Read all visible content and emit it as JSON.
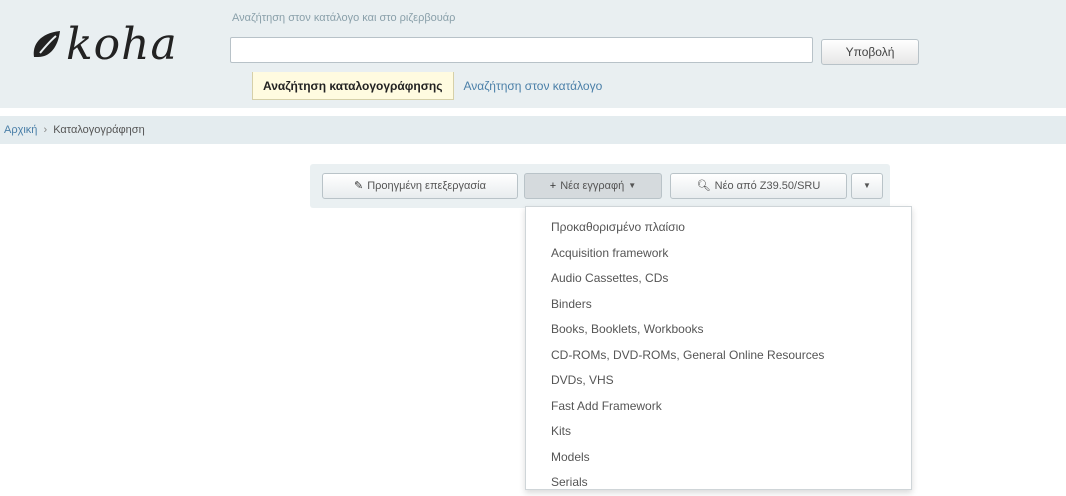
{
  "header": {
    "logo_text": "koha",
    "search_label": "Αναζήτηση στον κατάλογο και στο ριζερβουάρ",
    "search_value": "",
    "submit_label": "Υποβολή",
    "tabs": [
      {
        "label": "Αναζήτηση καταλογογράφησης",
        "active": true
      },
      {
        "label": "Αναζήτηση στον κατάλογο",
        "active": false
      }
    ]
  },
  "breadcrumb": {
    "home": "Αρχική",
    "separator": "›",
    "current": "Καταλογογράφηση"
  },
  "toolbar": {
    "resume_label": "Προηγμένη επεξεργασία",
    "new_record_label": "Νέα εγγραφή",
    "z3950_label": "Νέο από Z39.50/SRU",
    "icons": {
      "resume": "pencil-icon",
      "new": "plus-icon",
      "z3950": "search-icon",
      "caret": "caret-down-icon"
    }
  },
  "dropdown": {
    "items": [
      "Προκαθορισμένο πλαίσιο",
      "Acquisition framework",
      "Audio Cassettes, CDs",
      "Binders",
      "Books, Booklets, Workbooks",
      "CD-ROMs, DVD-ROMs, General Online Resources",
      "DVDs, VHS",
      "Fast Add Framework",
      "Kits",
      "Models",
      "Serials"
    ]
  },
  "colors": {
    "header_bg": "#e9eff1",
    "active_tab_bg": "#fffbe0",
    "link": "#4a7fa8"
  }
}
